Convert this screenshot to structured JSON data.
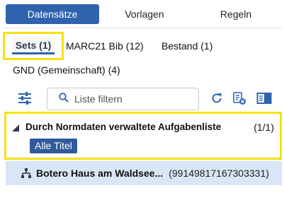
{
  "top_tabs": [
    {
      "label": "Datensätze",
      "active": true
    },
    {
      "label": "Vorlagen",
      "active": false
    },
    {
      "label": "Regeln",
      "active": false
    }
  ],
  "sub_tabs": {
    "sets": "Sets (1)",
    "marc21": "MARC21 Bib (12)",
    "bestand": "Bestand (1)",
    "gnd": "GND (Gemeinschaft) (4)"
  },
  "toolbar": {
    "search_placeholder": "Liste filtern",
    "icons": [
      "filter-settings-icon",
      "search-icon",
      "refresh-icon",
      "export-list-icon",
      "side-panel-icon"
    ]
  },
  "task_list": {
    "title": "Durch Normdaten verwaltete Aufgabenliste",
    "count": "(1/1)",
    "filter_label": "Alle Titel"
  },
  "record": {
    "title": "Botero Haus am Waldsee...",
    "id": "(99149817167303331)",
    "icon": "hierarchy-icon"
  },
  "colors": {
    "accent": "#2f63ad",
    "badge": "#2f5a9b",
    "highlight": "#f7e011",
    "selected_row": "#d8e6f6"
  }
}
